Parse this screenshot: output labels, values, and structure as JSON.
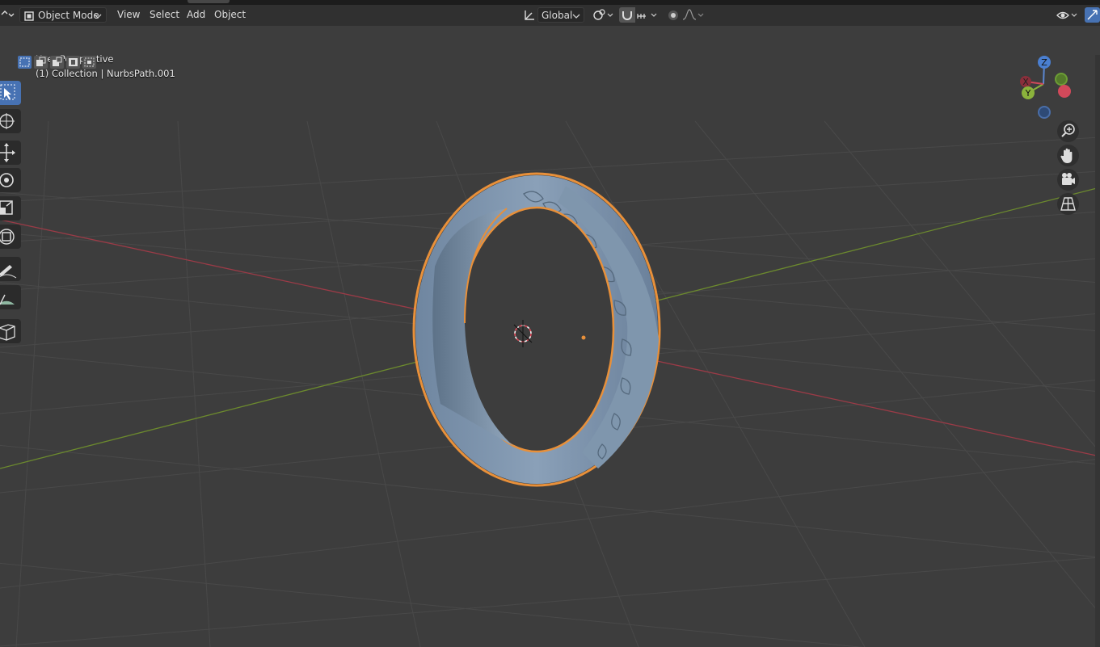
{
  "header": {
    "mode_label": "Object Mode",
    "menus": [
      "View",
      "Select",
      "Add",
      "Object"
    ],
    "transform_orientation": "Global"
  },
  "viewport": {
    "view_name": "User Perspective",
    "collection_info": "(1) Collection | NurbsPath.001"
  },
  "gizmo": {
    "z_label": "Z",
    "x_label": "X",
    "y_label": "Y"
  },
  "toolbar": {
    "tools": [
      "select-box-tool",
      "cursor-tool",
      "move-tool",
      "rotate-tool",
      "scale-tool",
      "transform-tool",
      "annotate-tool",
      "measure-tool",
      "add-cube-tool"
    ],
    "active": "select-box-tool"
  },
  "colors": {
    "grid_bg": "#3d3d3d",
    "x_axis": "#9b3b47",
    "y_axis": "#6c8a2e",
    "selection_outline": "#e8903a",
    "object": "#7d93a8",
    "accent": "#4772b3"
  }
}
